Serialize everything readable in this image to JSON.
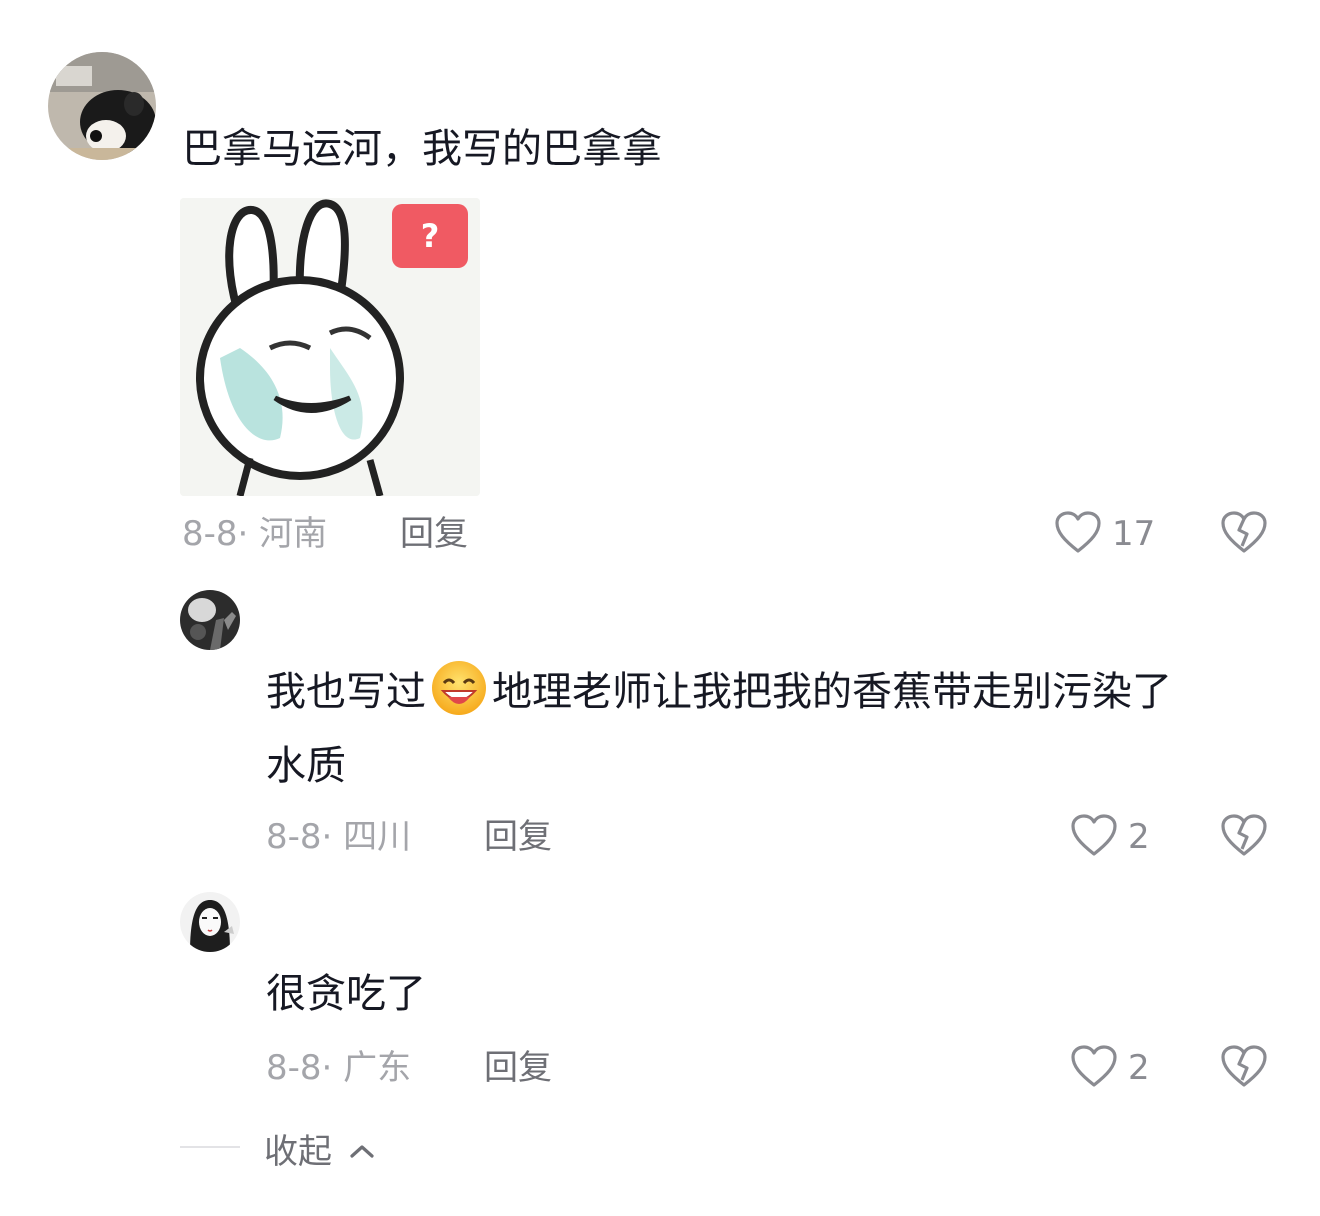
{
  "comments": [
    {
      "text": "巴拿马运河，我写的巴拿拿",
      "sticker_badge": "?",
      "meta": "8-8· 河南",
      "reply": "回复",
      "likes": "17"
    },
    {
      "text_before_emoji": "我也写过",
      "emoji": "grinning-sweat-emoji",
      "text_line1_after": "地理老师让我把我的香蕉带走别污染了",
      "text_line2": "水质",
      "meta": "8-8· 四川",
      "reply": "回复",
      "likes": "2"
    },
    {
      "text": "很贪吃了",
      "meta": "8-8· 广东",
      "reply": "回复",
      "likes": "2"
    }
  ],
  "collapse_label": "收起",
  "icons": {
    "like": "heart-outline-icon",
    "dislike": "broken-heart-icon",
    "collapse": "chevron-up-icon"
  },
  "colors": {
    "text": "#161823",
    "meta": "#a4a5aa",
    "reply": "#6e6f75",
    "badge": "#f05a63"
  }
}
